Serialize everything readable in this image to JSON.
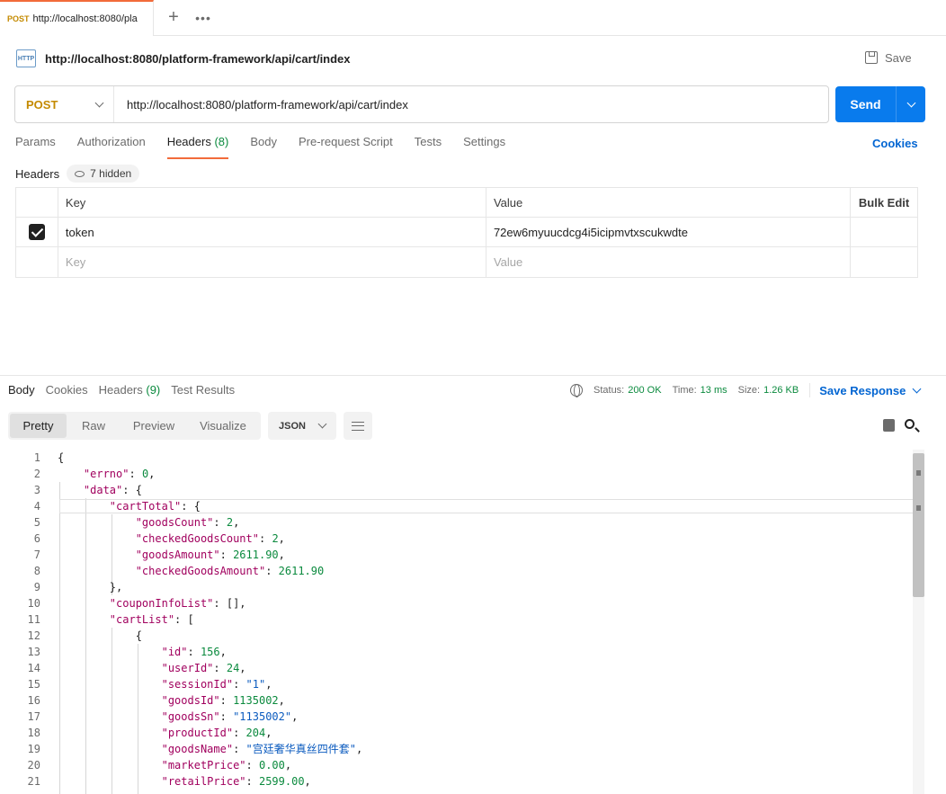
{
  "tab": {
    "method": "POST",
    "url": "http://localhost:8080/pla",
    "add": "+",
    "more": "•••"
  },
  "request": {
    "icon_label": "HTTP",
    "title": "http://localhost:8080/platform-framework/api/cart/index",
    "save": "Save",
    "method": "POST",
    "url": "http://localhost:8080/platform-framework/api/cart/index",
    "send": "Send"
  },
  "req_tabs": [
    {
      "label": "Params",
      "count": ""
    },
    {
      "label": "Authorization",
      "count": ""
    },
    {
      "label": "Headers",
      "count": "(8)"
    },
    {
      "label": "Body",
      "count": ""
    },
    {
      "label": "Pre-request Script",
      "count": ""
    },
    {
      "label": "Tests",
      "count": ""
    },
    {
      "label": "Settings",
      "count": ""
    }
  ],
  "cookies_link": "Cookies",
  "headers_section": {
    "label": "Headers",
    "hidden": "7 hidden"
  },
  "headers_table": {
    "columns": [
      "Key",
      "Value",
      "Bulk Edit"
    ],
    "rows": [
      {
        "key": "token",
        "value": "72ew6myuucdcg4i5icipmvtxscukwdte",
        "checked": true
      }
    ],
    "placeholder_key": "Key",
    "placeholder_value": "Value"
  },
  "response": {
    "tabs": [
      {
        "label": "Body",
        "count": ""
      },
      {
        "label": "Cookies",
        "count": ""
      },
      {
        "label": "Headers",
        "count": "(9)"
      },
      {
        "label": "Test Results",
        "count": ""
      }
    ],
    "status_label": "Status:",
    "status": "200 OK",
    "time_label": "Time:",
    "time": "13 ms",
    "size_label": "Size:",
    "size": "1.26 KB",
    "save_response": "Save Response",
    "views": [
      "Pretty",
      "Raw",
      "Preview",
      "Visualize"
    ],
    "format": "JSON"
  },
  "code_lines": [
    [
      [
        "p",
        "{"
      ]
    ],
    [
      [
        "p",
        "    "
      ],
      [
        "k",
        "\"errno\""
      ],
      [
        "p",
        ": "
      ],
      [
        "n",
        "0"
      ],
      [
        "p",
        ","
      ]
    ],
    [
      [
        "p",
        "    "
      ],
      [
        "k",
        "\"data\""
      ],
      [
        "p",
        ": {"
      ]
    ],
    [
      [
        "p",
        "        "
      ],
      [
        "k",
        "\"cartTotal\""
      ],
      [
        "p",
        ": {"
      ]
    ],
    [
      [
        "p",
        "            "
      ],
      [
        "k",
        "\"goodsCount\""
      ],
      [
        "p",
        ": "
      ],
      [
        "n",
        "2"
      ],
      [
        "p",
        ","
      ]
    ],
    [
      [
        "p",
        "            "
      ],
      [
        "k",
        "\"checkedGoodsCount\""
      ],
      [
        "p",
        ": "
      ],
      [
        "n",
        "2"
      ],
      [
        "p",
        ","
      ]
    ],
    [
      [
        "p",
        "            "
      ],
      [
        "k",
        "\"goodsAmount\""
      ],
      [
        "p",
        ": "
      ],
      [
        "n",
        "2611.90"
      ],
      [
        "p",
        ","
      ]
    ],
    [
      [
        "p",
        "            "
      ],
      [
        "k",
        "\"checkedGoodsAmount\""
      ],
      [
        "p",
        ": "
      ],
      [
        "n",
        "2611.90"
      ]
    ],
    [
      [
        "p",
        "        },"
      ]
    ],
    [
      [
        "p",
        "        "
      ],
      [
        "k",
        "\"couponInfoList\""
      ],
      [
        "p",
        ": [],"
      ]
    ],
    [
      [
        "p",
        "        "
      ],
      [
        "k",
        "\"cartList\""
      ],
      [
        "p",
        ": ["
      ]
    ],
    [
      [
        "p",
        "            {"
      ]
    ],
    [
      [
        "p",
        "                "
      ],
      [
        "k",
        "\"id\""
      ],
      [
        "p",
        ": "
      ],
      [
        "n",
        "156"
      ],
      [
        "p",
        ","
      ]
    ],
    [
      [
        "p",
        "                "
      ],
      [
        "k",
        "\"userId\""
      ],
      [
        "p",
        ": "
      ],
      [
        "n",
        "24"
      ],
      [
        "p",
        ","
      ]
    ],
    [
      [
        "p",
        "                "
      ],
      [
        "k",
        "\"sessionId\""
      ],
      [
        "p",
        ": "
      ],
      [
        "s",
        "\"1\""
      ],
      [
        "p",
        ","
      ]
    ],
    [
      [
        "p",
        "                "
      ],
      [
        "k",
        "\"goodsId\""
      ],
      [
        "p",
        ": "
      ],
      [
        "n",
        "1135002"
      ],
      [
        "p",
        ","
      ]
    ],
    [
      [
        "p",
        "                "
      ],
      [
        "k",
        "\"goodsSn\""
      ],
      [
        "p",
        ": "
      ],
      [
        "s",
        "\"1135002\""
      ],
      [
        "p",
        ","
      ]
    ],
    [
      [
        "p",
        "                "
      ],
      [
        "k",
        "\"productId\""
      ],
      [
        "p",
        ": "
      ],
      [
        "n",
        "204"
      ],
      [
        "p",
        ","
      ]
    ],
    [
      [
        "p",
        "                "
      ],
      [
        "k",
        "\"goodsName\""
      ],
      [
        "p",
        ": "
      ],
      [
        "s",
        "\"宫廷奢华真丝四件套\""
      ],
      [
        "p",
        ","
      ]
    ],
    [
      [
        "p",
        "                "
      ],
      [
        "k",
        "\"marketPrice\""
      ],
      [
        "p",
        ": "
      ],
      [
        "n",
        "0.00"
      ],
      [
        "p",
        ","
      ]
    ],
    [
      [
        "p",
        "                "
      ],
      [
        "k",
        "\"retailPrice\""
      ],
      [
        "p",
        ": "
      ],
      [
        "n",
        "2599.00"
      ],
      [
        "p",
        ","
      ]
    ]
  ],
  "colors": {
    "accent": "#f26b3a",
    "send": "#097bed",
    "link": "#0265d2",
    "method": "#c48a00",
    "ok": "#0b8a3e",
    "json_key": "#a1005e",
    "json_string": "#0b5bbf",
    "json_number": "#0b8a3e"
  }
}
